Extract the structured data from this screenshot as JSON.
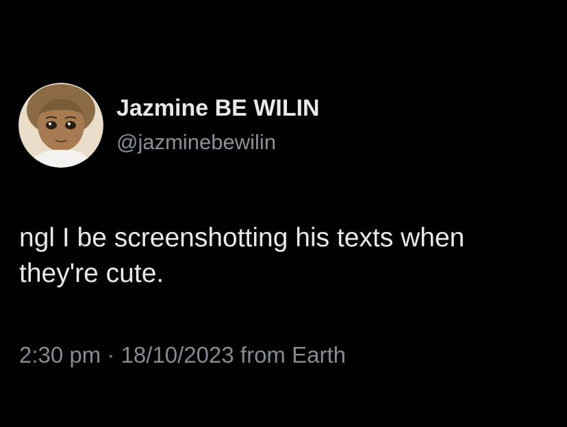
{
  "tweet": {
    "display_name": "Jazmine BE WILIN",
    "handle": "@jazminebewilin",
    "text_line_1": "ngl I be screenshotting his texts when",
    "text_line_2": "they're cute.",
    "time": "2:30 pm",
    "separator": " · ",
    "date": "18/10/2023",
    "source": " from Earth"
  },
  "avatar": {
    "icon": "cartoon-girl-avatar"
  },
  "colors": {
    "background": "#000000",
    "primary_text": "#e7e9ea",
    "secondary_text": "#8b9097"
  }
}
